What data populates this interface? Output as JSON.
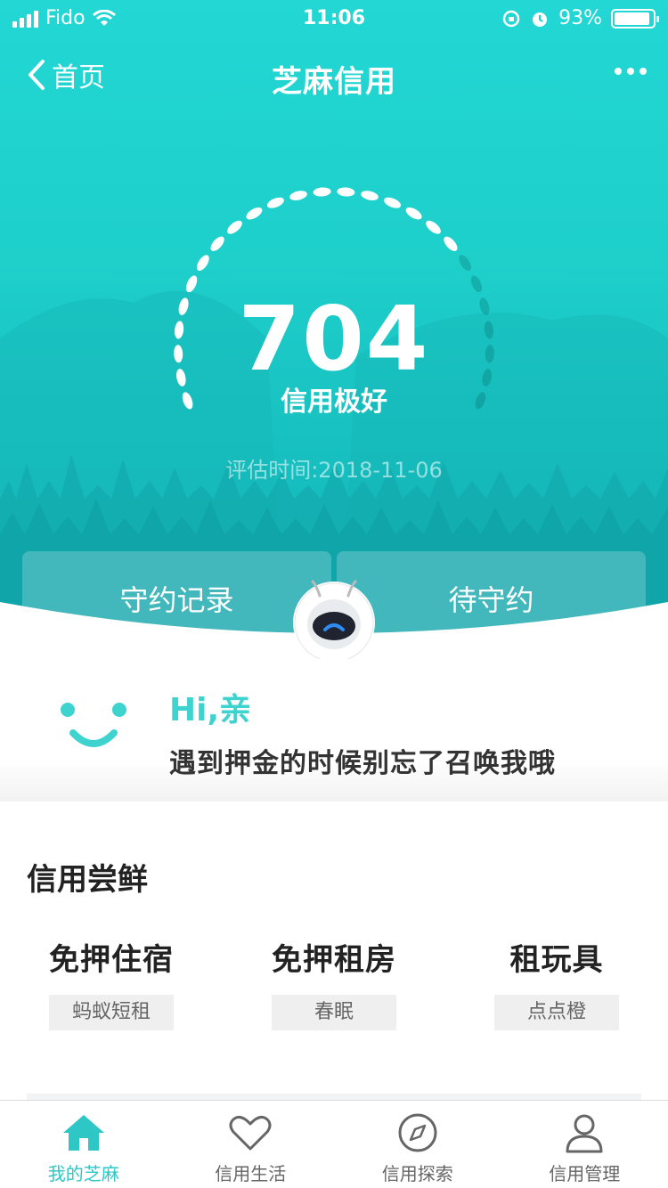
{
  "status": {
    "carrier": "Fido",
    "time": "11:06",
    "battery": "93%",
    "battery_level": 0.93
  },
  "nav": {
    "back_label": "首页",
    "title": "芝麻信用",
    "more_icon": "ellipsis-icon"
  },
  "score": {
    "value": "704",
    "level": "信用极好",
    "eval_time": "评估时间:2018-11-06"
  },
  "tabs": {
    "left": "守约记录",
    "right": "待守约"
  },
  "greeting": {
    "hi": "Hi,亲",
    "message": "遇到押金的时候别忘了召唤我哦"
  },
  "section": {
    "title": "信用尝鲜",
    "offers": [
      {
        "name": "免押住宿",
        "tag": "蚂蚁短租"
      },
      {
        "name": "免押租房",
        "tag": "春眠"
      },
      {
        "name": "租玩具",
        "tag": "点点橙"
      }
    ]
  },
  "tabbar": {
    "items": [
      {
        "label": "我的芝麻",
        "icon": "home-icon",
        "active": true
      },
      {
        "label": "信用生活",
        "icon": "heart-icon",
        "active": false
      },
      {
        "label": "信用探索",
        "icon": "compass-icon",
        "active": false
      },
      {
        "label": "信用管理",
        "icon": "user-icon",
        "active": false
      }
    ]
  },
  "colors": {
    "accent": "#1ecfca",
    "active_tab": "#2fc6c6"
  }
}
